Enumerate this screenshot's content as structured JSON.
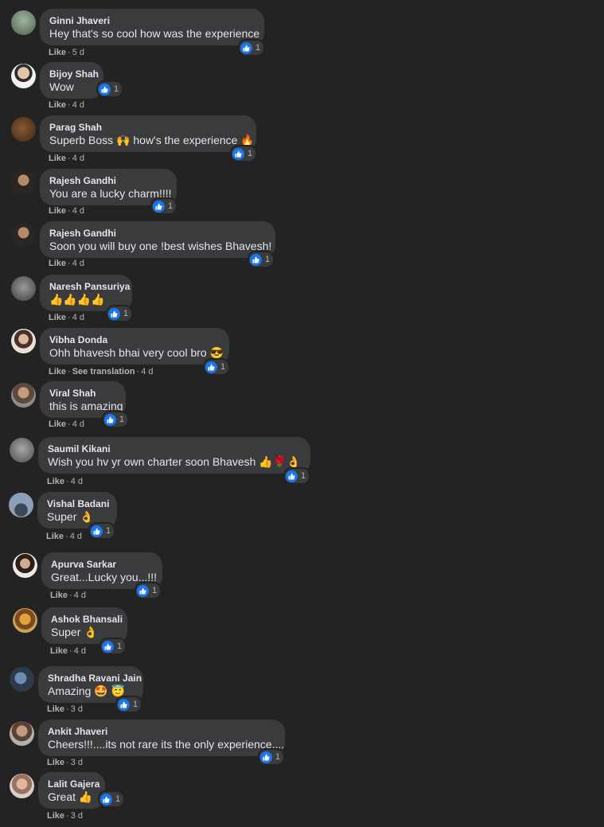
{
  "colors": {
    "background": "#232324",
    "bubble": "#3a3b3c",
    "text": "#e4e6eb",
    "meta": "#b0b3b8",
    "like_blue": "#1877f2"
  },
  "actions": {
    "like": "Like",
    "see_translation": "See translation"
  },
  "comments": [
    {
      "author": "Ginni Jhaveri",
      "text": "Hey that's so cool how was the experience",
      "emoji": "",
      "time": "5 d",
      "reactions": "1",
      "icon": "like-icon"
    },
    {
      "author": "Bijoy Shah",
      "text": "Wow",
      "emoji": "",
      "time": "4 d",
      "reactions": "1",
      "icon": "like-icon"
    },
    {
      "author": "Parag Shah",
      "text": "Superb Boss 🙌 how's the experience 🔥",
      "emoji": "",
      "time": "4 d",
      "reactions": "1",
      "icon": "like-icon"
    },
    {
      "author": "Rajesh Gandhi",
      "text": "You are a lucky charm!!!!",
      "emoji": "",
      "time": "4 d",
      "reactions": "1",
      "icon": "like-icon"
    },
    {
      "author": "Rajesh Gandhi",
      "text": "Soon you will buy one !best wishes Bhavesh!",
      "emoji": "",
      "time": "4 d",
      "reactions": "1",
      "icon": "like-icon"
    },
    {
      "author": "Naresh Pansuriya",
      "text": "👍👍👍👍",
      "emoji": "",
      "time": "4 d",
      "reactions": "1",
      "icon": "like-icon"
    },
    {
      "author": "Vibha Donda",
      "text": "Ohh bhavesh bhai very cool bro 😎",
      "emoji": "",
      "time": "4 d",
      "reactions": "1",
      "icon": "like-icon"
    },
    {
      "author": "Viral Shah",
      "text": "this is amazing",
      "emoji": "",
      "time": "4 d",
      "reactions": "1",
      "icon": "like-icon"
    },
    {
      "author": "Saumil Kikani",
      "text": "Wish you hv yr own charter soon Bhavesh 👍🌹👌",
      "emoji": "",
      "time": "4 d",
      "reactions": "1",
      "icon": "like-icon"
    },
    {
      "author": "Vishal Badani",
      "text": "Super 👌",
      "emoji": "",
      "time": "4 d",
      "reactions": "1",
      "icon": "like-icon"
    },
    {
      "author": "Apurva Sarkar",
      "text": "Great...Lucky you...!!!",
      "emoji": "",
      "time": "4 d",
      "reactions": "1",
      "icon": "like-icon"
    },
    {
      "author": "Ashok Bhansali",
      "text": "Super 👌",
      "emoji": "",
      "time": "4 d",
      "reactions": "1",
      "icon": "like-icon"
    },
    {
      "author": "Shradha Ravani Jain",
      "text": "Amazing 🤩 😇",
      "emoji": "",
      "time": "3 d",
      "reactions": "1",
      "icon": "like-icon"
    },
    {
      "author": "Ankit Jhaveri",
      "text": "Cheers!!!....its not rare its the only experience....",
      "emoji": "",
      "time": "3 d",
      "reactions": "1",
      "icon": "like-icon"
    },
    {
      "author": "Lalit Gajera",
      "text": "Great 👍",
      "emoji": "",
      "time": "3 d",
      "reactions": "1",
      "icon": "like-icon"
    }
  ]
}
